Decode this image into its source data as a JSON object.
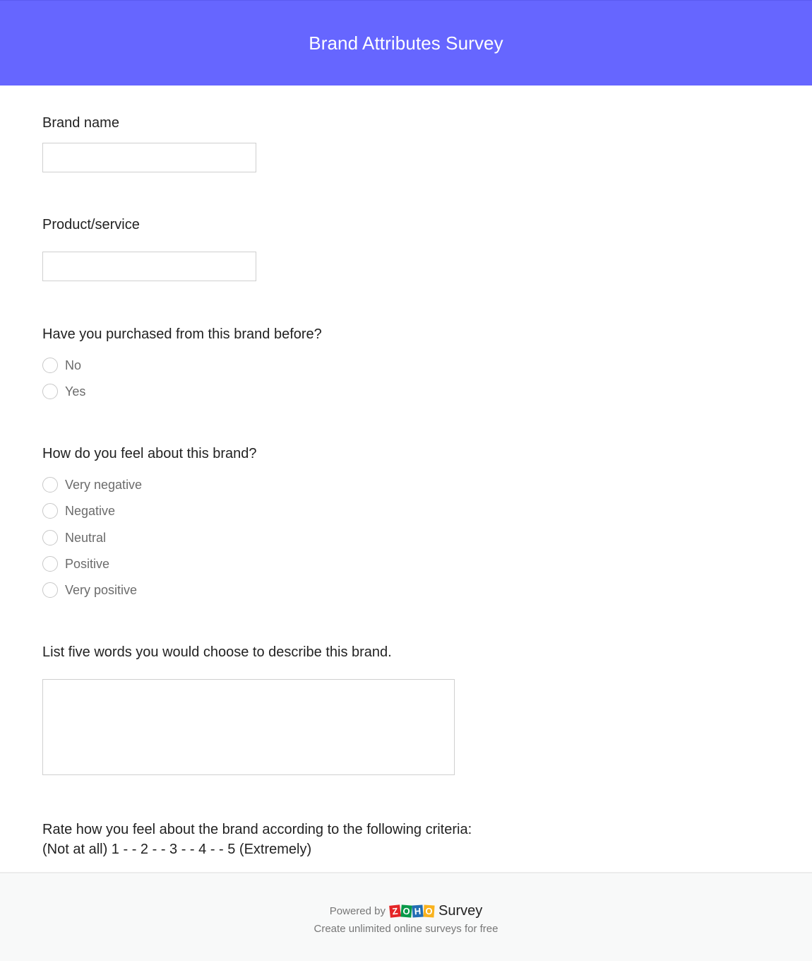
{
  "header": {
    "title": "Brand Attributes Survey",
    "bg_color": "#6666ff"
  },
  "questions": {
    "brand_name": {
      "label": "Brand name",
      "value": "",
      "placeholder": ""
    },
    "product_service": {
      "label": "Product/service",
      "value": "",
      "placeholder": ""
    },
    "purchased_before": {
      "label": "Have you purchased from this brand before?",
      "options": [
        "No",
        "Yes"
      ],
      "selected": null
    },
    "feeling": {
      "label": "How do you feel about this brand?",
      "options": [
        "Very negative",
        "Negative",
        "Neutral",
        "Positive",
        "Very positive"
      ],
      "selected": null
    },
    "five_words": {
      "label": "List five words you would choose to describe this brand.",
      "value": "",
      "placeholder": ""
    },
    "rating": {
      "label_line1": "Rate how you feel about the brand according to the following criteria:",
      "label_line2": "(Not at all) 1 - - 2 - - 3 - - 4 - - 5 (Extremely)"
    }
  },
  "footer": {
    "powered_by": "Powered by",
    "logo_letters": [
      "Z",
      "O",
      "H",
      "O"
    ],
    "product": "Survey",
    "tagline": "Create unlimited online surveys for free"
  }
}
